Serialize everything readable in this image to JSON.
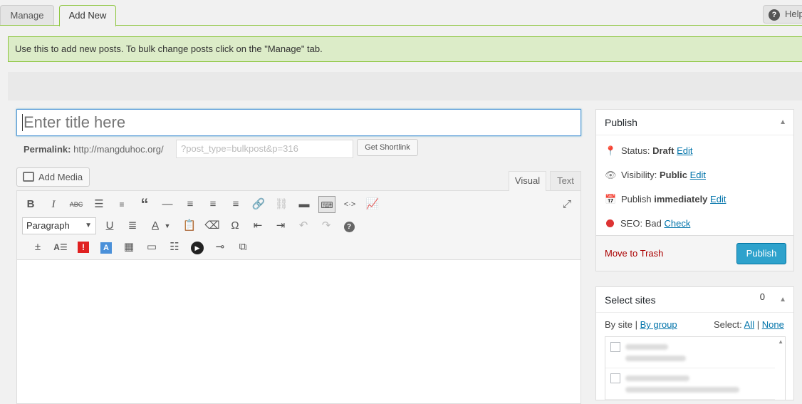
{
  "tabs": {
    "manage": "Manage",
    "add_new": "Add New",
    "help": "Help"
  },
  "notice": "Use this to add new posts. To bulk change posts click on the \"Manage\" tab.",
  "title_placeholder": "Enter title here",
  "permalink": {
    "label": "Permalink:",
    "base": "http://mangduhoc.org/",
    "slug": "?post_type=bulkpost&p=316",
    "shortlink_button": "Get Shortlink"
  },
  "editor": {
    "add_media": "Add Media",
    "tab_visual": "Visual",
    "tab_text": "Text",
    "format_select": "Paragraph",
    "toolbar_row1": [
      "bold-icon",
      "italic-icon",
      "strikethrough-icon",
      "bullet-list-icon",
      "numbered-list-icon",
      "blockquote-icon",
      "horizontal-line-icon",
      "align-left-icon",
      "align-center-icon",
      "align-right-icon",
      "insert-link-icon",
      "remove-link-icon",
      "read-more-icon",
      "toolbar-toggle-icon",
      "code-icon",
      "chart-icon"
    ],
    "toolbar_row2": [
      "underline-icon",
      "justify-icon",
      "text-color-icon",
      "paste-text-icon",
      "clear-format-icon",
      "special-char-icon",
      "outdent-icon",
      "indent-icon",
      "undo-icon",
      "redo-icon",
      "help-icon"
    ],
    "toolbar_row3": [
      "plus-minus-icon",
      "ae-icon",
      "alert-icon",
      "a-box-icon",
      "layout-icon",
      "page-icon",
      "columns-icon",
      "play-icon",
      "separator-icon",
      "video-icon"
    ]
  },
  "publish_box": {
    "title": "Publish",
    "status_label": "Status:",
    "status_value": "Draft",
    "status_edit": "Edit",
    "visibility_label": "Visibility:",
    "visibility_value": "Public",
    "visibility_edit": "Edit",
    "publish_label": "Publish",
    "publish_value": "immediately",
    "publish_edit": "Edit",
    "seo_label": "SEO:",
    "seo_value": "Bad",
    "seo_check": "Check",
    "trash": "Move to Trash",
    "publish_button": "Publish"
  },
  "sites_box": {
    "title": "Select sites",
    "count": "0",
    "by_site": "By site",
    "by_group": "By group",
    "select_label": "Select:",
    "all": "All",
    "none": "None"
  },
  "colors": {
    "accent_green": "#8dc63f",
    "notice_bg": "#dcecc8",
    "publish_button": "#2ea2cc",
    "seo_bad": "#dd3333",
    "trash": "#aa0000"
  }
}
